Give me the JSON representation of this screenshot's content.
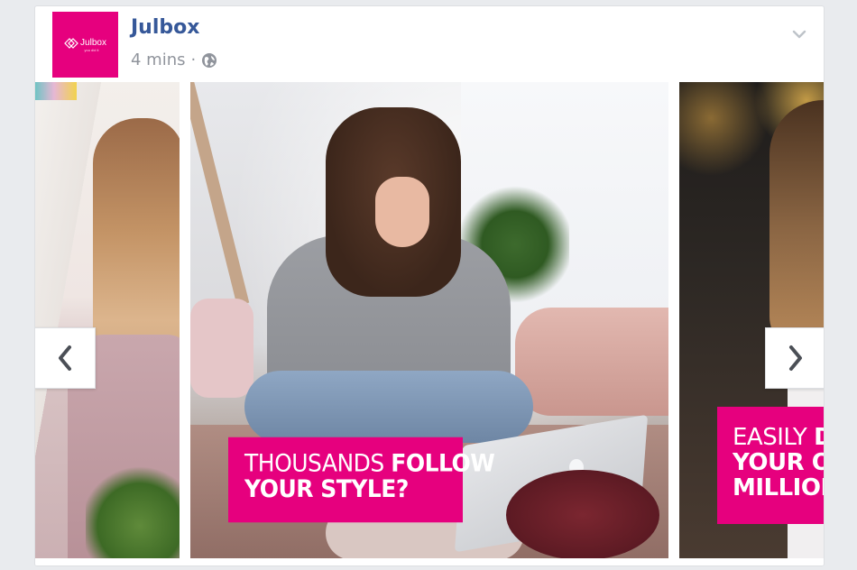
{
  "post": {
    "page_name": "Julbox",
    "timestamp": "4 mins",
    "separator": "·",
    "avatar": {
      "brand": "Julbox",
      "tagline": "you did it",
      "color": "#e6007e"
    },
    "menu_icon": "chevron-down-icon",
    "privacy_icon": "globe-icon"
  },
  "carousel": {
    "accent_color": "#e6007e",
    "nav": {
      "prev_icon": "chevron-left-icon",
      "next_icon": "chevron-right-icon"
    },
    "cards": [
      {
        "caption_lines": []
      },
      {
        "caption_line1_light": "THOUSANDS ",
        "caption_line1_bold": "FOLLOW",
        "caption_line2_bold": " YOUR STYLE?"
      },
      {
        "caption_line1_light": "EASILY ",
        "caption_line1_bold": "DE",
        "caption_line2_bold": "YOUR OW",
        "caption_line3_bold": "MILLIONS"
      }
    ]
  }
}
